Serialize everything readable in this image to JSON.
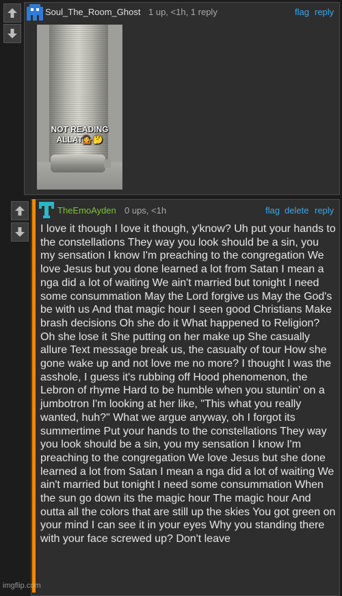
{
  "comment1": {
    "username": "Soul_The_Room_Ghost",
    "meta": "1 up, <1h, 1 reply",
    "actions": [
      "flag",
      "reply"
    ],
    "image": {
      "caption_line1": "NOT READING",
      "caption_line2": "ALLAT"
    },
    "user_color": "#e0e0e0",
    "avatar_color": "#2f7bd6"
  },
  "comment2": {
    "username": "TheEmoAyden",
    "meta": "0 ups, <1h",
    "actions": [
      "flag",
      "delete",
      "reply"
    ],
    "user_color": "#7ec23a",
    "avatar_color": "#28b8c8",
    "body": "I love it though I love it though, y'know? Uh put your hands to the constellations They way you look should be a sin, you my sensation I know I'm preaching to the congregation We love Jesus but you done learned a lot from Satan I mean a nga did a lot of waiting We ain't married but tonight I need some consummation May the Lord forgive us May the God's be with us And that magic hour I seen good Christians Make brash decisions Oh she do it What happened to Religion? Oh she lose it She putting on her make up She casually allure Text message break us, the casualty of tour How she gone wake up and not love me no more? I thought I was the asshole, I guess it's rubbing off Hood phenomenon, the Lebron of rhyme Hard to be humble when you stuntin' on a jumbotron I'm looking at her like, \"This what you really wanted, huh?\" What we argue anyway, oh I forgot its summertime Put your hands to the constellations They way you look should be a sin, you my sensation I know I'm preaching to the congregation We love Jesus but she done learned a lot from Satan I mean a nga did a lot of waiting We ain't married but tonight I need some consummation When the sun go down its the magic hour The magic hour And outta all the colors that are still up the skies You got green on your mind I can see it in your eyes Why you standing there with your face screwed up? Don't leave"
  },
  "watermark": "imgflip.com",
  "accent_color": "#f08a00",
  "link_color": "#3aa8e8"
}
